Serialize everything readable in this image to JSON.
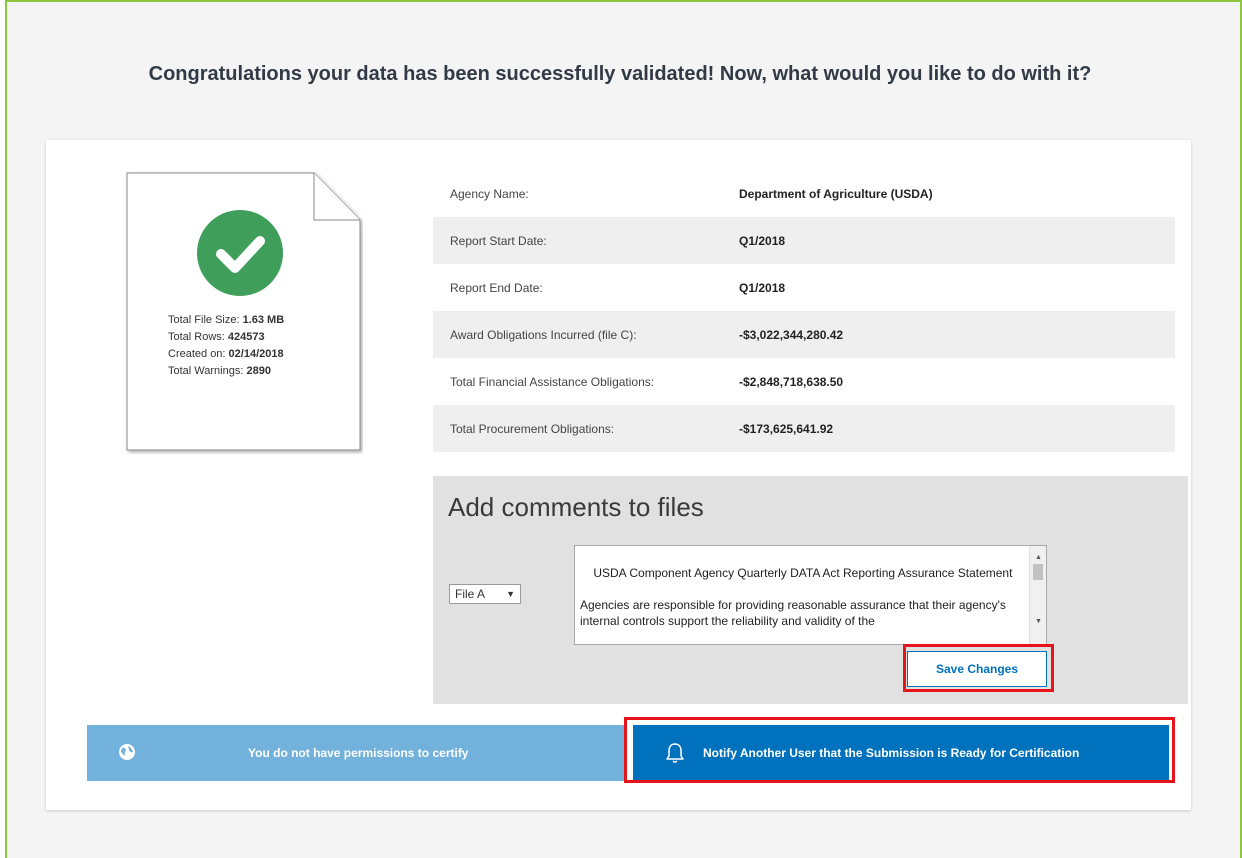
{
  "headline": "Congratulations your data has been successfully validated! Now, what would you like to do with it?",
  "file_stats": {
    "size_label": "Total File Size: ",
    "size_value": "1.63 MB",
    "rows_label": "Total Rows: ",
    "rows_value": "424573",
    "created_label": "Created on: ",
    "created_value": "02/14/2018",
    "warnings_label": "Total Warnings: ",
    "warnings_value": "2890"
  },
  "info": [
    {
      "key": "Agency Name:",
      "value": "Department of Agriculture (USDA)"
    },
    {
      "key": "Report Start Date:",
      "value": "Q1/2018"
    },
    {
      "key": "Report End Date:",
      "value": "Q1/2018"
    },
    {
      "key": "Award Obligations Incurred (file C):",
      "value": "-$3,022,344,280.42"
    },
    {
      "key": "Total Financial Assistance Obligations:",
      "value": "-$2,848,718,638.50"
    },
    {
      "key": "Total Procurement Obligations:",
      "value": "-$173,625,641.92"
    }
  ],
  "comments": {
    "title": "Add comments to files",
    "file_select": "File A",
    "text": "USDA Component Agency Quarterly DATA Act Reporting Assurance Statement\n\nAgencies are responsible for providing reasonable assurance that their agency's internal controls support the reliability and validity of the",
    "save_label": "Save Changes"
  },
  "actions": {
    "certify_label": "You do not have permissions to certify",
    "notify_label": "Notify Another User that the Submission is Ready for Certification"
  },
  "colors": {
    "primary": "#0071bc",
    "certify_disabled": "#72b1dc",
    "success": "#3e9e5a",
    "highlight": "#e8141b",
    "frame_border": "#8dc63f"
  }
}
